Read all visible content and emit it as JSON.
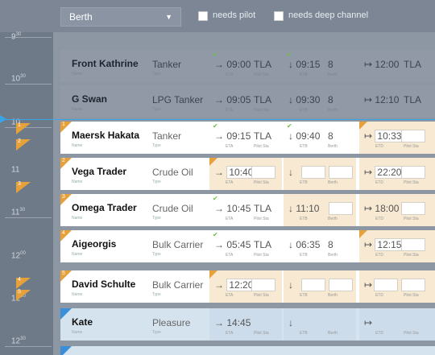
{
  "filter": {
    "select_value": "Berth",
    "needs_pilot_label": "needs pilot",
    "needs_deep_channel_label": "needs deep channel"
  },
  "timeline": {
    "ticks": [
      "9",
      "10",
      "10",
      "11",
      "11",
      "12",
      "12",
      "12"
    ],
    "tick_minutes": [
      "30",
      "30",
      "",
      "",
      "30",
      "00",
      "30",
      "30"
    ],
    "badges": [
      "1",
      "2",
      "3",
      "4",
      "5"
    ]
  },
  "sublabels": {
    "name": "Name",
    "type": "Type",
    "eta": "ETA",
    "pilot_sta": "Pilot Sta",
    "etb": "ETB",
    "berth": "Berth",
    "etd": "ETD"
  },
  "rows": [
    {
      "num": "",
      "name": "Front Kathrine",
      "type": "Tanker",
      "eta": "09:00",
      "pilot": "TLA",
      "etb": "09:15",
      "berth": "8",
      "etd": "12:00",
      "pilot2": "TLA"
    },
    {
      "num": "",
      "name": "G Swan",
      "type": "LPG Tanker",
      "eta": "09:05",
      "pilot": "TLA",
      "etb": "09:30",
      "berth": "8",
      "etd": "12:10",
      "pilot2": "TLA"
    },
    {
      "num": "1",
      "name": "Maersk Hakata",
      "type": "Tanker",
      "eta": "09:15",
      "pilot": "TLA",
      "etb": "09:40",
      "berth": "8",
      "etd": "10:33",
      "pilot2": ""
    },
    {
      "num": "2",
      "name": "Vega Trader",
      "type": "Crude Oil",
      "eta": "10:40",
      "pilot": "",
      "etb": "",
      "berth": "",
      "etd": "22:20",
      "pilot2": ""
    },
    {
      "num": "3",
      "name": "Omega Trader",
      "type": "Crude Oil",
      "eta": "10:45",
      "pilot": "TLA",
      "etb": "11:10",
      "berth": "",
      "etd": "18:00",
      "pilot2": ""
    },
    {
      "num": "4",
      "name": "Aigeorgis",
      "type": "Bulk Carrier",
      "eta": "05:45",
      "pilot": "TLA",
      "etb": "06:35",
      "berth": "8",
      "etd": "12:15",
      "pilot2": ""
    },
    {
      "num": "5",
      "name": "David Schulte",
      "type": "Bulk Carrier",
      "eta": "12:20",
      "pilot": "",
      "etb": "",
      "berth": "",
      "etd": "",
      "pilot2": ""
    },
    {
      "num": "",
      "name": "Kate",
      "type": "Pleasure",
      "eta": "14:45",
      "pilot": "",
      "etb": "",
      "berth": "",
      "etd": "",
      "pilot2": ""
    }
  ],
  "icons": {
    "eta": "arrow-right-to-bar-icon",
    "etb": "arrow-down-icon",
    "etd": "bar-arrow-right-icon",
    "caret": "chevron-down-icon",
    "check": "check-icon"
  },
  "colors": {
    "accent": "#38a6e6",
    "badge": "#e6a13a",
    "ok": "#6dbf3f"
  }
}
